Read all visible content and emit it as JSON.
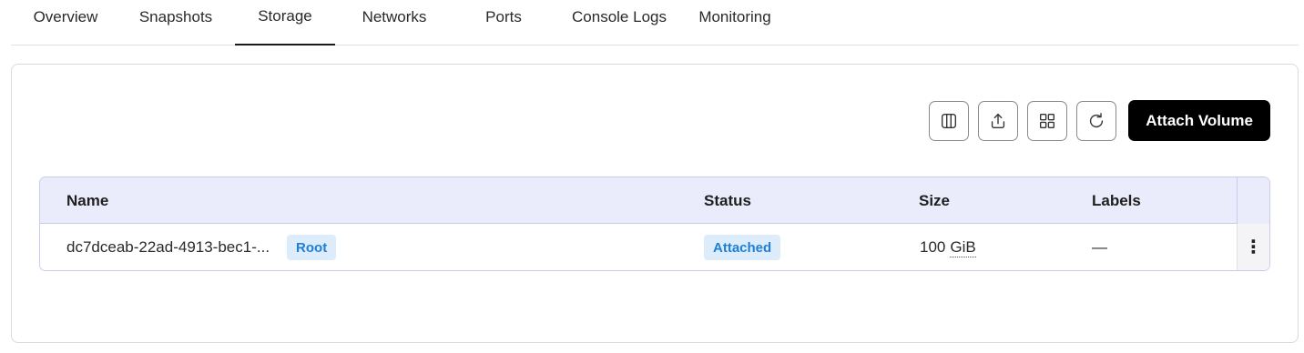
{
  "tabs": [
    {
      "label": "Overview",
      "active": false
    },
    {
      "label": "Snapshots",
      "active": false
    },
    {
      "label": "Storage",
      "active": true
    },
    {
      "label": "Networks",
      "active": false
    },
    {
      "label": "Ports",
      "active": false
    },
    {
      "label": "Console Logs",
      "active": false
    },
    {
      "label": "Monitoring",
      "active": false
    }
  ],
  "toolbar": {
    "icons": [
      "columns-icon",
      "export-icon",
      "grid-icon",
      "refresh-icon"
    ],
    "attach_label": "Attach Volume"
  },
  "table": {
    "headers": {
      "name": "Name",
      "status": "Status",
      "size": "Size",
      "labels": "Labels"
    },
    "rows": [
      {
        "name": "dc7dceab-22ad-4913-bec1-...",
        "name_badge": "Root",
        "status": "Attached",
        "size_value": "100",
        "size_unit": "GiB",
        "labels": "—"
      }
    ]
  },
  "colors": {
    "accent": "#000000",
    "badge_bg": "#dcecfb",
    "badge_text": "#1f7fd6",
    "header_bg": "#ebecfb"
  }
}
